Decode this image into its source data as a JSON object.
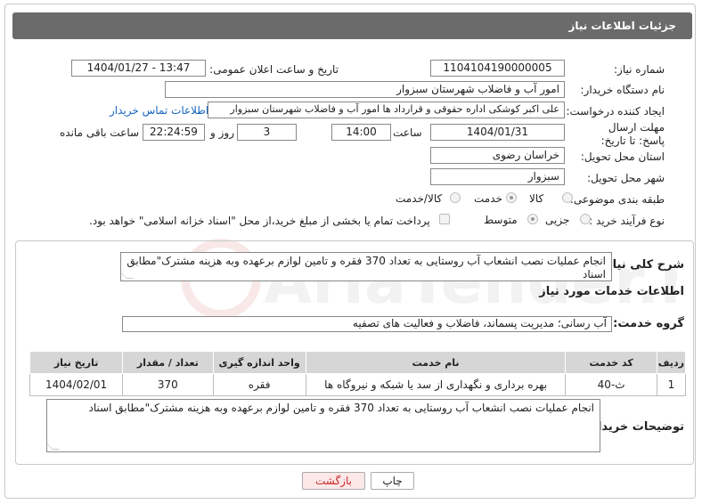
{
  "header": {
    "title": "جزئیات اطلاعات نیاز"
  },
  "fields": {
    "need_number_label": "شماره نیاز:",
    "need_number": "1104104190000005",
    "announce_label": "تاریخ و ساعت اعلان عمومی:",
    "announce_value": "1404/01/27 - 13:47",
    "buyer_org_label": "نام دستگاه خریدار:",
    "buyer_org": "امور آب و فاضلاب شهرستان سبزوار",
    "creator_label": "ایجاد کننده درخواست:",
    "creator": "علی اکبر کوشکی اداره حقوقی و قرارداد ها امور آب و فاضلاب شهرستان سبزوار",
    "contact_link": "اطلاعات تماس خریدار",
    "deadline_label": "مهلت ارسال پاسخ: تا تاریخ:",
    "deadline_date": "1404/01/31",
    "time_label": "ساعت",
    "deadline_time": "14:00",
    "days_value": "3",
    "days_label": "روز و",
    "remaining_time": "22:24:59",
    "remaining_label": "ساعت باقی مانده",
    "province_label": "استان محل تحویل:",
    "province": "خراسان رضوی",
    "city_label": "شهر محل تحویل:",
    "city": "سبزوار",
    "category_label": "طبقه بندی موضوعی:",
    "category_options": [
      "کالا",
      "خدمت",
      "کالا/خدمت"
    ],
    "process_label": "نوع فرآیند خرید :",
    "process_options": [
      "جزیی",
      "متوسط"
    ],
    "payment_note": "پرداخت تمام یا بخشی از مبلغ خرید،از محل \"اسناد خزانه اسلامی\" خواهد بود."
  },
  "summary": {
    "label": "شرح کلی نیاز:",
    "text": "انجام عملیات نصب انشعاب آب روستایی به تعداد 370 فقره و تامین لوازم برعهده وبه هزینه مشترک\"مطابق اسناد"
  },
  "services": {
    "title": "اطلاعات خدمات مورد نیاز",
    "group_label": "گروه خدمت:",
    "group_value": "آب رسانی؛ مدیریت پسماند، فاضلاب و فعالیت های تصفیه",
    "columns": [
      "ردیف",
      "کد خدمت",
      "نام خدمت",
      "واحد اندازه گیری",
      "تعداد / مقدار",
      "تاریخ نیاز"
    ],
    "rows": [
      [
        "1",
        "ث-40",
        "بهره برداری و نگهداری از سد یا شبکه و نیروگاه ها",
        "فقره",
        "370",
        "1404/02/01"
      ]
    ]
  },
  "buyer_notes": {
    "label": "توضیحات خریدار:",
    "text": "انجام عملیات نصب انشعاب آب روستایی به تعداد 370 فقره و تامین لوازم برعهده وبه هزینه مشترک\"مطابق اسناد"
  },
  "buttons": {
    "print": "چاپ",
    "back": "بازگشت"
  },
  "watermark": "AriaTender.neT",
  "colors": {
    "header_bg": "#6b6b6b",
    "link": "#1565c0",
    "back_btn_bg": "#fde8e8",
    "back_btn_text": "#c62828"
  }
}
